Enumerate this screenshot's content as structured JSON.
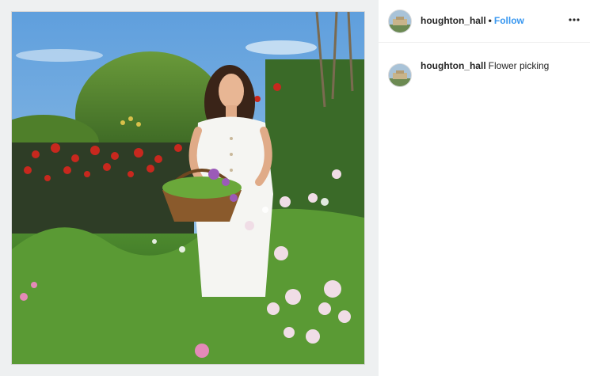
{
  "post": {
    "author": {
      "username": "houghton_hall",
      "follow_label": "Follow",
      "separator": "•"
    },
    "caption": {
      "username": "houghton_hall",
      "text": "Flower picking"
    },
    "more_options_icon": "more-horizontal-icon",
    "image_subject": "woman-in-white-dress-with-flower-basket-in-garden",
    "colors": {
      "follow_blue": "#3897f0",
      "text_dark": "#262626",
      "frame_gray": "#eef0f1"
    }
  }
}
